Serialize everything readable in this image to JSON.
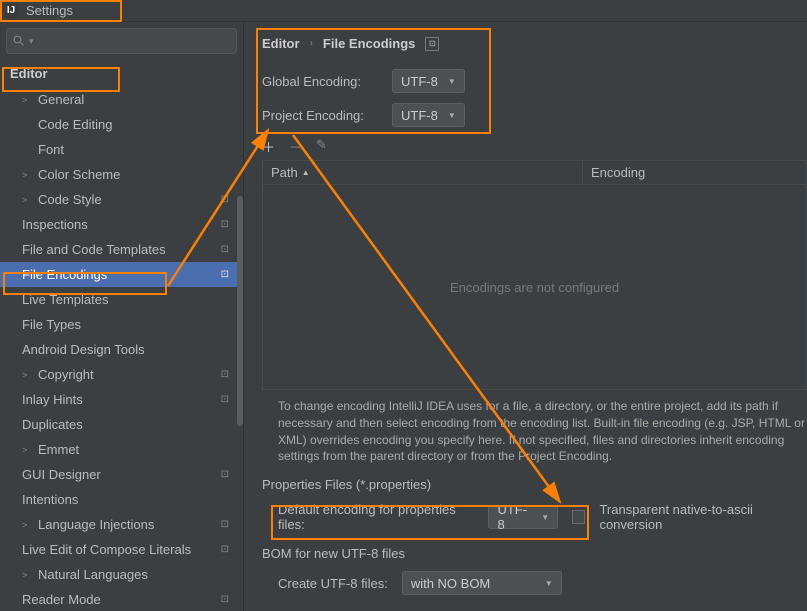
{
  "window": {
    "title": "Settings"
  },
  "search": {
    "placeholder": ""
  },
  "sidebar": {
    "header": "Editor",
    "items": [
      {
        "label": "General",
        "expandable": true
      },
      {
        "label": "Code Editing",
        "indent": true
      },
      {
        "label": "Font",
        "indent": true
      },
      {
        "label": "Color Scheme",
        "expandable": true
      },
      {
        "label": "Code Style",
        "expandable": true,
        "badge": "⊡"
      },
      {
        "label": "Inspections",
        "badge": "⊡"
      },
      {
        "label": "File and Code Templates",
        "badge": "⊡"
      },
      {
        "label": "File Encodings",
        "badge": "⊡",
        "selected": true
      },
      {
        "label": "Live Templates"
      },
      {
        "label": "File Types"
      },
      {
        "label": "Android Design Tools"
      },
      {
        "label": "Copyright",
        "expandable": true,
        "badge": "⊡"
      },
      {
        "label": "Inlay Hints",
        "badge": "⊡"
      },
      {
        "label": "Duplicates"
      },
      {
        "label": "Emmet",
        "expandable": true
      },
      {
        "label": "GUI Designer",
        "badge": "⊡"
      },
      {
        "label": "Intentions"
      },
      {
        "label": "Language Injections",
        "expandable": true,
        "badge": "⊡"
      },
      {
        "label": "Live Edit of Compose Literals",
        "badge": "⊡"
      },
      {
        "label": "Natural Languages",
        "expandable": true
      },
      {
        "label": "Reader Mode",
        "badge": "⊡"
      }
    ]
  },
  "breadcrumb": {
    "root": "Editor",
    "leaf": "File Encodings"
  },
  "encodings": {
    "global_label": "Global Encoding:",
    "global_value": "UTF-8",
    "project_label": "Project Encoding:",
    "project_value": "UTF-8"
  },
  "table": {
    "col_path": "Path",
    "col_encoding": "Encoding",
    "empty": "Encodings are not configured"
  },
  "helptext": "To change encoding IntelliJ IDEA uses for a file, a directory, or the entire project, add its path if necessary and then select encoding from the encoding list. Built-in file encoding (e.g. JSP, HTML or XML) overrides encoding you specify here. If not specified, files and directories inherit encoding settings from the parent directory or from the Project Encoding.",
  "properties": {
    "section": "Properties Files (*.properties)",
    "default_label": "Default encoding for properties files:",
    "default_value": "UTF-8",
    "transparent_label": "Transparent native-to-ascii conversion"
  },
  "bom": {
    "section": "BOM for new UTF-8 files",
    "create_label": "Create UTF-8 files:",
    "create_value": "with NO BOM"
  }
}
